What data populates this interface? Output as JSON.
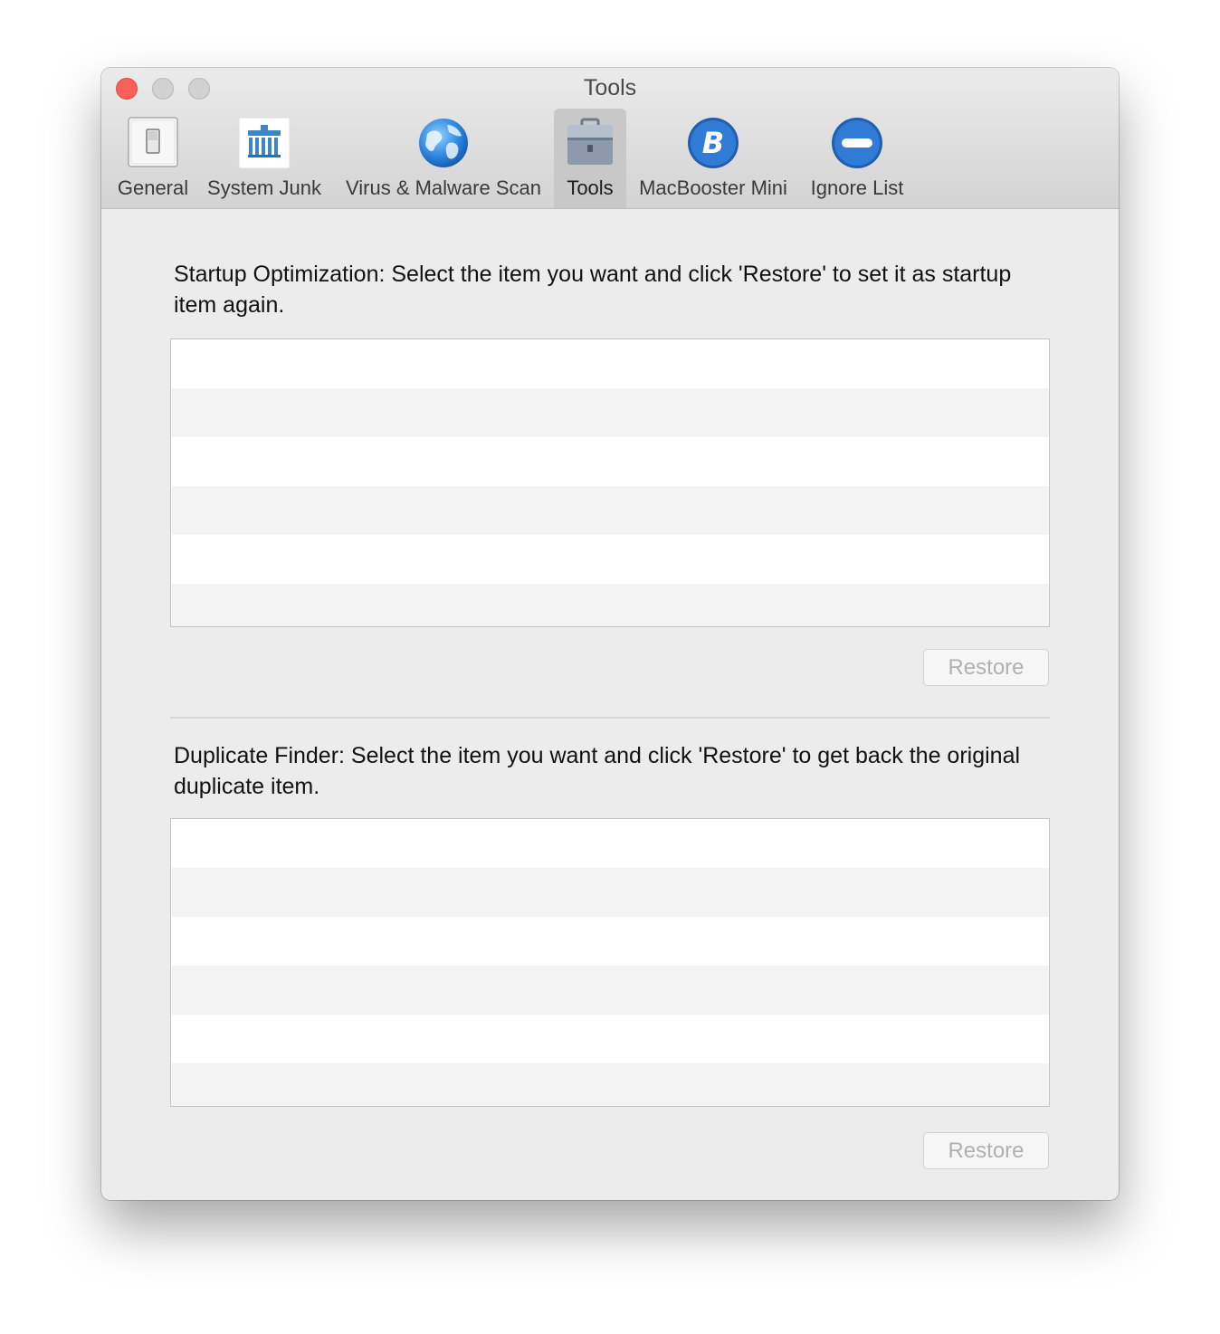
{
  "window": {
    "title": "Tools"
  },
  "toolbar": {
    "items": [
      {
        "label": "General",
        "icon": "switch-icon"
      },
      {
        "label": "System Junk",
        "icon": "broom-icon"
      },
      {
        "label": "Virus & Malware Scan",
        "icon": "globe-icon"
      },
      {
        "label": "Tools",
        "icon": "toolbox-icon",
        "selected": true
      },
      {
        "label": "MacBooster Mini",
        "icon": "macbooster-b-icon"
      },
      {
        "label": "Ignore List",
        "icon": "no-entry-icon"
      }
    ]
  },
  "startup": {
    "description": "Startup Optimization: Select the item you want and click 'Restore' to set it as startup item again.",
    "restore_label": "Restore"
  },
  "duplicate": {
    "description": "Duplicate Finder:  Select the item you want and click 'Restore' to get back the original duplicate item.",
    "restore_label": "Restore"
  },
  "colors": {
    "close": "#fc5f57",
    "accent_blue": "#2f7bd6",
    "disabled_text": "#b0b0b0"
  }
}
